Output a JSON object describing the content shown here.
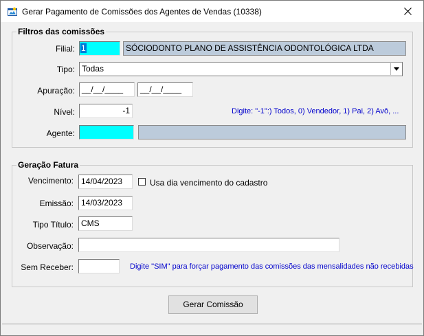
{
  "window": {
    "title": "Gerar Pagamento de Comissões dos Agentes de Vendas (10338)",
    "icon": "app-window-icon",
    "close_icon": "close-icon"
  },
  "filtros": {
    "legend": "Filtros das comissões",
    "filial": {
      "label": "Filial:",
      "code": "1",
      "name": "SÓCIODONTO PLANO DE ASSISTÊNCIA ODONTOLÓGICA LTDA"
    },
    "tipo": {
      "label": "Tipo:",
      "selected": "Todas"
    },
    "apuracao": {
      "label": "Apuração:",
      "from": "__/__/____",
      "to": "__/__/____"
    },
    "nivel": {
      "label": "Nível:",
      "value": "-1",
      "hint": "Digite: \"-1\":) Todos, 0) Vendedor, 1) Pai, 2) Avô, ..."
    },
    "agente": {
      "label": "Agente:",
      "code": "",
      "name": ""
    }
  },
  "geracao": {
    "legend": "Geração Fatura",
    "vencimento": {
      "label": "Vencimento:",
      "value": "14/04/2023",
      "checkbox_label": "Usa dia vencimento do cadastro",
      "checked": false
    },
    "emissao": {
      "label": "Emissão:",
      "value": "14/03/2023"
    },
    "tipo_titulo": {
      "label": "Tipo Título:",
      "value": "CMS"
    },
    "observacao": {
      "label": "Observação:",
      "value": ""
    },
    "sem_receber": {
      "label": "Sem Receber:",
      "value": "",
      "hint": "Digite \"SIM\" para forçar pagamento das comissões das mensalidades não recebidas"
    }
  },
  "actions": {
    "gerar_label": "Gerar Comissão"
  },
  "colors": {
    "required_field": "#00ffff",
    "readonly_field": "#bccbdb",
    "hint_text": "#0000cc"
  }
}
